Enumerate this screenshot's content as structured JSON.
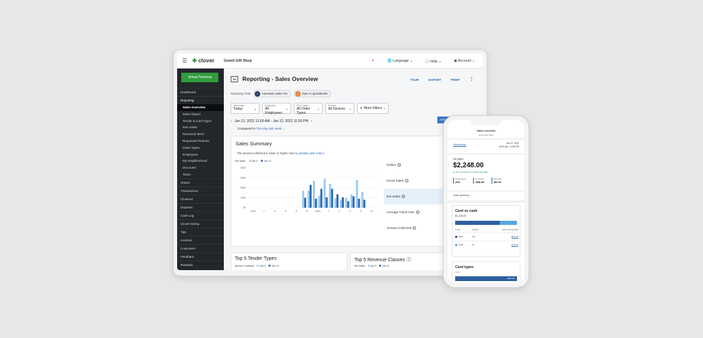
{
  "topbar": {
    "menu_icon": "hamburger-icon",
    "brand": "clover",
    "merchant": "Grand Gift Shop",
    "language": "Language",
    "help": "Help",
    "account": "Account"
  },
  "sidebar": {
    "virtual_terminal": "Virtual Terminal",
    "items_top": [
      "Dashboard",
      "Reporting"
    ],
    "reporting_sub": [
      "Sales Overview",
      "Sales Report",
      "Tender & Card Types",
      "Item Sales",
      "Removed Items",
      "Requested Reports",
      "Order Types",
      "Employees",
      "My Neighborhood",
      "Discounts",
      "Taxes"
    ],
    "active_sub": "Sales Overview",
    "items_bottom": [
      "Orders",
      "Transactions",
      "Closeout",
      "Disputes",
      "Cash Log",
      "Clover Dining",
      "Tips",
      "Invoices",
      "Customers",
      "Feedback",
      "Rewards"
    ]
  },
  "page": {
    "title": "Reporting - Sales Overview",
    "actions": [
      "TOUR",
      "EXPORT",
      "PRINT"
    ],
    "reporting_tools_label": "Reporting Tools",
    "tools": [
      "Automatic Sales Tax",
      "Sync to QuickBooks"
    ],
    "filters": [
      {
        "label": "Date range",
        "value": "Today"
      },
      {
        "label": "Employees",
        "value": "All Employees"
      },
      {
        "label": "Order Types",
        "value": "All Order Types"
      },
      {
        "label": "Devices",
        "value": "All Devices"
      }
    ],
    "more_filters": "More Filters",
    "date_range": "Jan 12, 2022 12:00 AM - Jan 12, 2022 11:59 PM",
    "compared_to_label": "Compared to",
    "compared_to_value": "This day last week",
    "trend_tab": "TRENDS"
  },
  "summary": {
    "title": "Sales Summary",
    "note_prefix": "The amount collected is lower or higher due to",
    "note_link": "partially paid orders.",
    "legend_title": "Net Sales",
    "legend": [
      {
        "name": "Jan 5",
        "color": "#9ccaf2"
      },
      {
        "name": "Jan 12",
        "color": "#2f6db5"
      }
    ],
    "metrics": [
      "Orders",
      "Gross Sales",
      "Net Sales",
      "Average Ticket Size",
      "Amount Collected"
    ],
    "active_metric": "Net Sales"
  },
  "chart_data": {
    "type": "bar",
    "ylim": [
      0,
      800
    ],
    "yticks": [
      "$0",
      "$200",
      "$400",
      "$600",
      "$800"
    ],
    "xticks": [
      "12am",
      "2",
      "4",
      "6",
      "8",
      "10",
      "12pm",
      "2",
      "4",
      "6",
      "8",
      "10"
    ],
    "categories": [
      "10am",
      "11am",
      "12pm",
      "1pm",
      "2pm",
      "3pm",
      "4pm",
      "5pm",
      "6pm",
      "7pm",
      "8pm",
      "9pm"
    ],
    "series": [
      {
        "name": "Jan 5",
        "color": "#9ccaf2",
        "values": [
          340,
          340,
          540,
          240,
          580,
          480,
          190,
          160,
          200,
          270,
          560,
          320
        ]
      },
      {
        "name": "Jan 12",
        "color": "#2f6db5",
        "values": [
          200,
          460,
          180,
          380,
          210,
          380,
          270,
          210,
          130,
          230,
          180,
          160
        ]
      }
    ]
  },
  "bottom_cards": [
    {
      "title": "Top 5 Tender Types",
      "legend_title": "Amount Collected",
      "legend": [
        "Jan 5",
        "Jan 12"
      ]
    },
    {
      "title": "Top 5 Revenue Classes",
      "legend_title": "Net Sales",
      "legend": [
        "Jan 5",
        "Jan 12"
      ]
    }
  ],
  "phone": {
    "title": "Sales overview",
    "subtitle": "Grand Gift Shop",
    "day": "Wednesday",
    "date": "Jan 12, 2022",
    "time": "12:00 AM - 11:59 PM",
    "net_label": "Net sales",
    "net_value": "$2,248.00",
    "pct_change": "▲ 4% compared to previous Saturday",
    "stats": [
      {
        "label": "Transactions",
        "value": "203"
      },
      {
        "label": "To refunds",
        "value": "-$96.00"
      },
      {
        "label": "Discounts",
        "value": "-$0.00"
      }
    ],
    "order_summary": "Order summary",
    "card_vs_cash": {
      "title": "Card vs cash",
      "amount": "$1,128.00",
      "card_fraction": 0.72,
      "headers": [
        "TYPE",
        "TRANS",
        "AMT COLLECTED"
      ],
      "rows": [
        {
          "type": "Card",
          "color": "#2f5f9f",
          "trans": "146",
          "amt": "$824.00"
        },
        {
          "type": "Cash",
          "color": "#5aa6e0",
          "trans": "55",
          "amt": "$326.00"
        }
      ]
    },
    "card_types": {
      "title": "Card types",
      "label": "VISA",
      "amount": "$824.00"
    }
  }
}
